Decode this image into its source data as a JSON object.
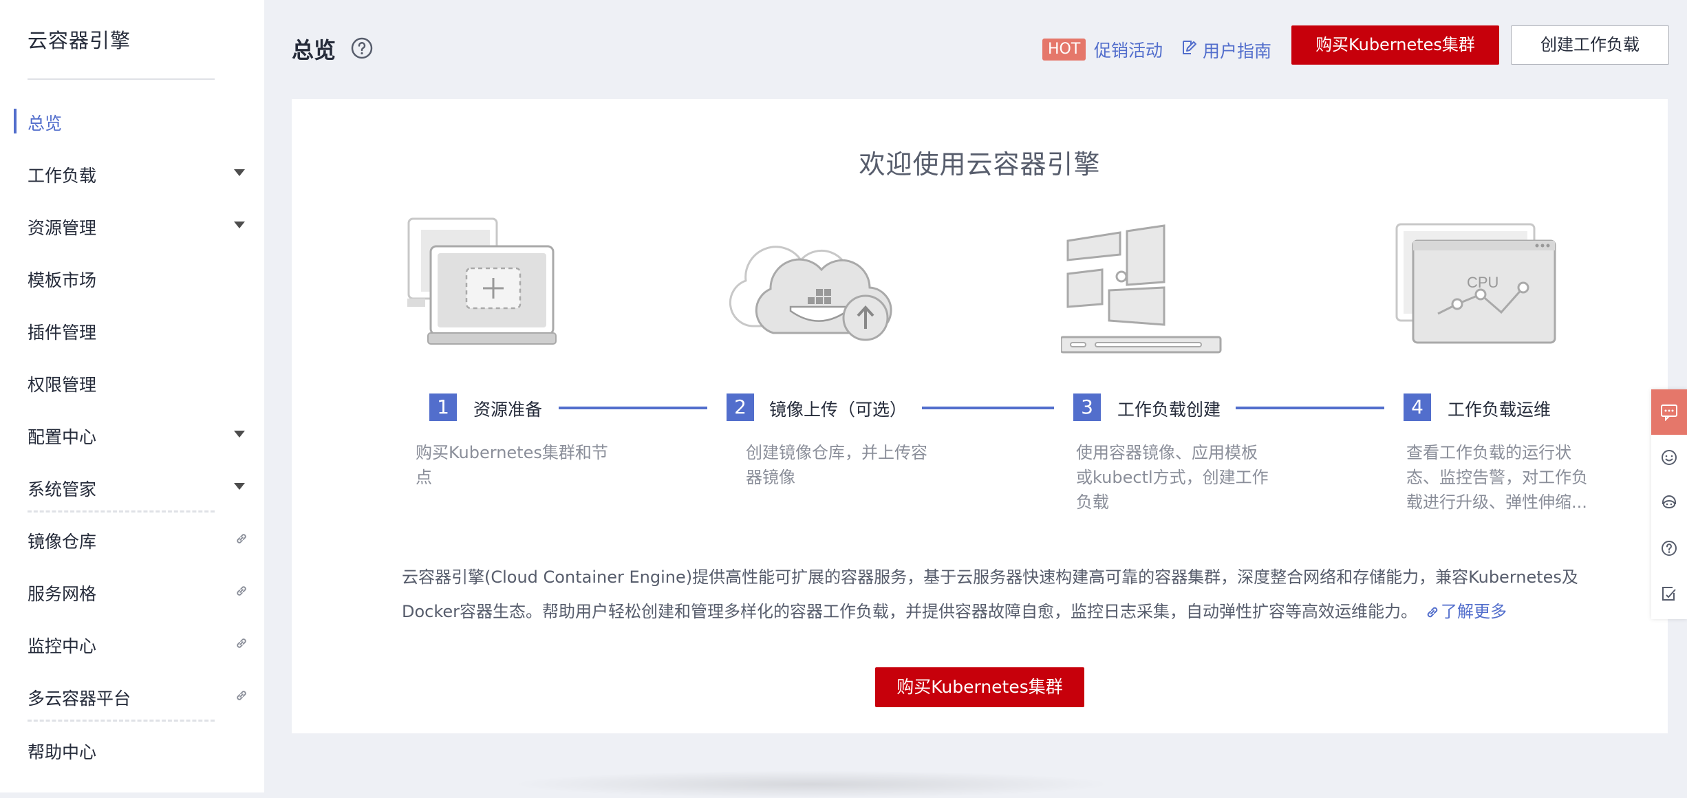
{
  "sidebar": {
    "title": "云容器引擎",
    "items": [
      {
        "label": "总览",
        "name": "sidebar-item-overview"
      },
      {
        "label": "工作负载",
        "name": "sidebar-item-workloads"
      },
      {
        "label": "资源管理",
        "name": "sidebar-item-resources"
      },
      {
        "label": "模板市场",
        "name": "sidebar-item-templates"
      },
      {
        "label": "插件管理",
        "name": "sidebar-item-addons"
      },
      {
        "label": "权限管理",
        "name": "sidebar-item-permissions"
      },
      {
        "label": "配置中心",
        "name": "sidebar-item-config"
      },
      {
        "label": "系统管家",
        "name": "sidebar-item-system"
      },
      {
        "label": "镜像仓库",
        "name": "sidebar-item-image-repo"
      },
      {
        "label": "服务网格",
        "name": "sidebar-item-service-mesh"
      },
      {
        "label": "监控中心",
        "name": "sidebar-item-monitoring"
      },
      {
        "label": "多云容器平台",
        "name": "sidebar-item-multicloud"
      },
      {
        "label": "帮助中心",
        "name": "sidebar-item-help"
      }
    ]
  },
  "header": {
    "title": "总览",
    "hot_badge": "HOT",
    "promo_label": "促销活动",
    "guide_label": "用户指南",
    "buy_button": "购买Kubernetes集群",
    "create_button": "创建工作负载"
  },
  "welcome": {
    "title": "欢迎使用云容器引擎",
    "cpu_label": "CPU",
    "steps": [
      {
        "num": "1",
        "title": "资源准备",
        "desc": [
          "购买Kubernetes集群和节",
          "点"
        ]
      },
      {
        "num": "2",
        "title": "镜像上传（可选）",
        "desc": [
          "创建镜像仓库，并上传容",
          "器镜像"
        ]
      },
      {
        "num": "3",
        "title": "工作负载创建",
        "desc": [
          "使用容器镜像、应用模板",
          "或kubectl方式，创建工作",
          "负载"
        ]
      },
      {
        "num": "4",
        "title": "工作负载运维",
        "desc": [
          "查看工作负载的运行状",
          "态、监控告警，对工作负",
          "载进行升级、弹性伸缩..."
        ]
      }
    ],
    "intro_line1": "云容器引擎(Cloud Container Engine)提供高性能可扩展的容器服务，基于云服务器快速构建高可靠的容器集群，深度整合网络和存储能力，兼容Kubernetes及",
    "intro_line2": "Docker容器生态。帮助用户轻松创建和管理多样化的容器工作负载，并提供容器故障自愈，监控日志采集，自动弹性扩容等高效运维能力。",
    "learn_more": "了解更多",
    "buy_button": "购买Kubernetes集群"
  },
  "colors": {
    "accent": "#526ecc",
    "brand_red": "#c7000b",
    "hot": "#e5776a"
  }
}
